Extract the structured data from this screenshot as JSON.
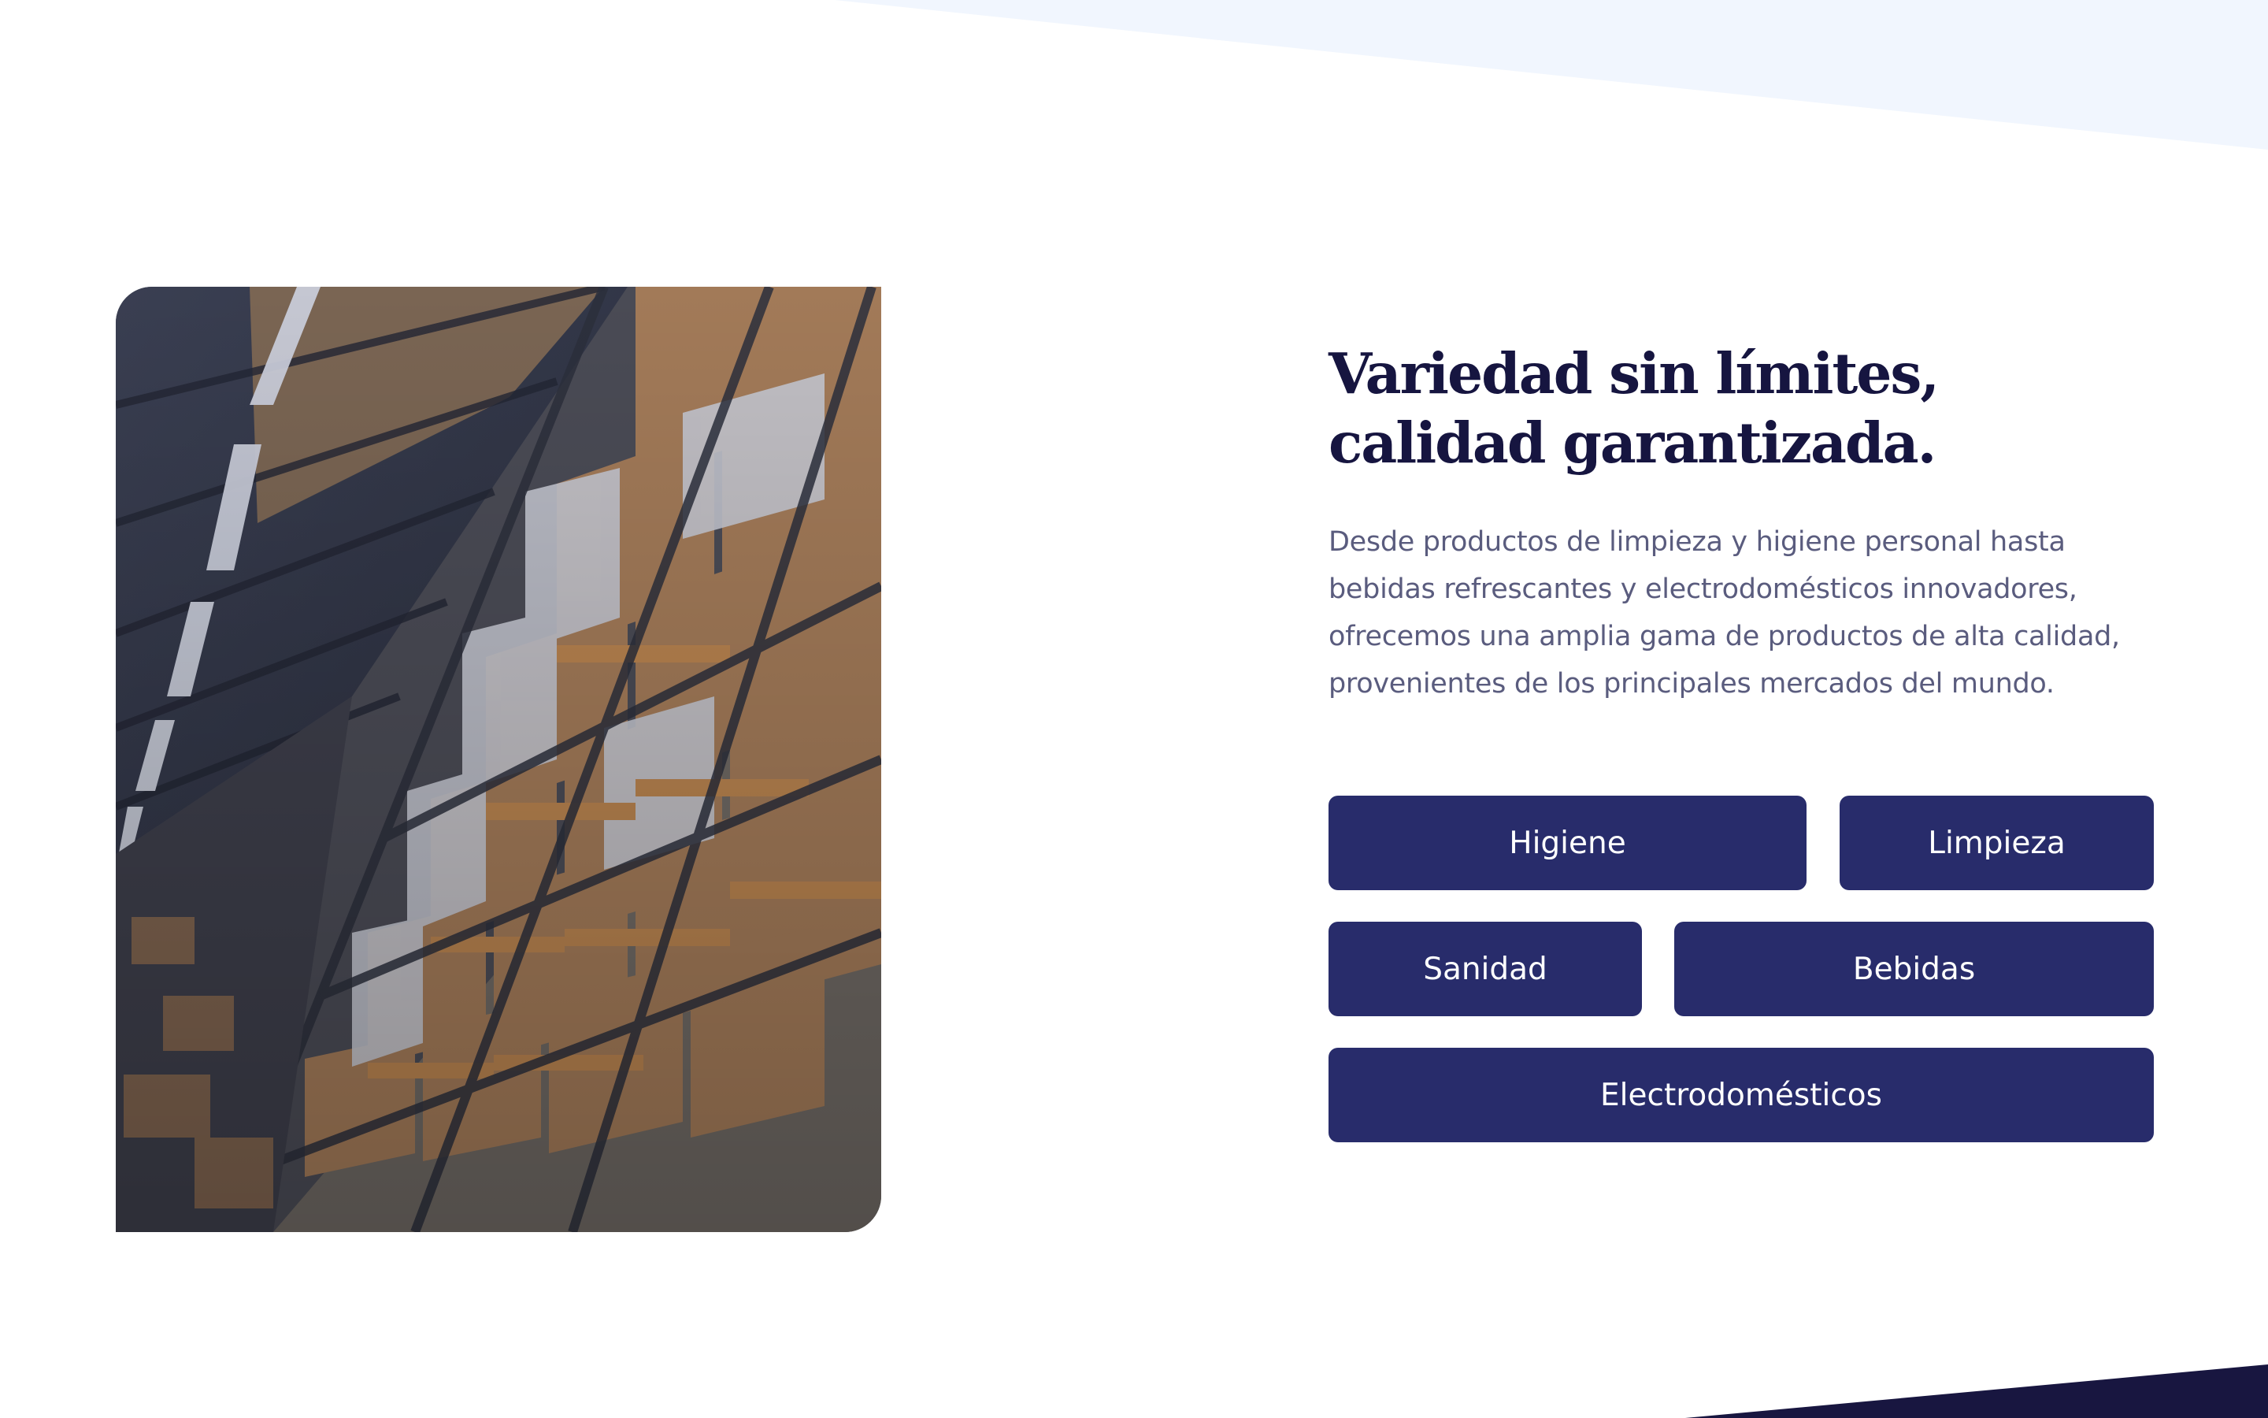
{
  "section": {
    "title_line1": "Variedad sin límites,",
    "title_line2": "calidad garantizada.",
    "description": "Desde productos de limpieza y higiene personal hasta bebidas refrescantes y electrodomésticos innovadores, ofrecemos una amplia gama de productos de alta calidad, provenientes de los principales mercados del mundo."
  },
  "categories": {
    "higiene": "Higiene",
    "limpieza": "Limpieza",
    "sanidad": "Sanidad",
    "bebidas": "Bebidas",
    "electrodomesticos": "Electrodomésticos"
  },
  "colors": {
    "heading": "#161540",
    "body_text": "#5a5c7e",
    "button_bg": "#282c6b",
    "button_text": "#ffffff",
    "top_band": "#f1f6fe",
    "bottom_band": "#181640"
  }
}
